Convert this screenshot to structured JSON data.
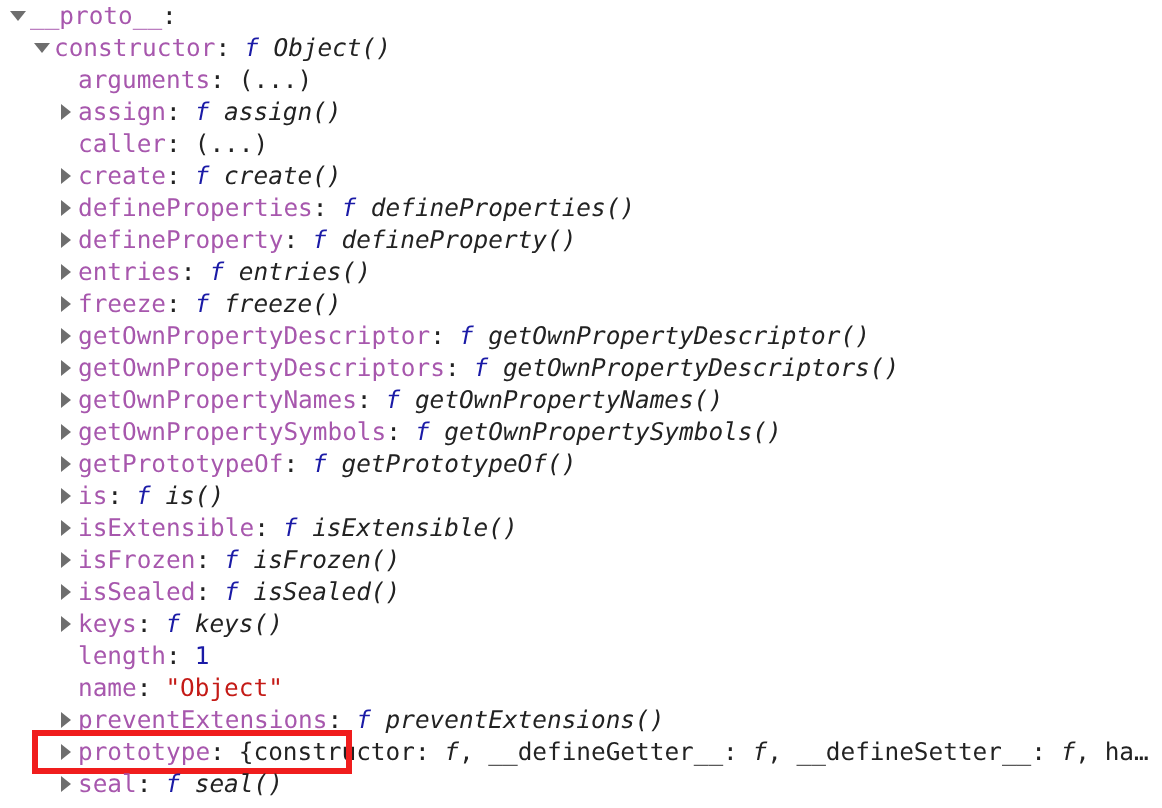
{
  "separator": ":",
  "tree": [
    {
      "key": "__proto__",
      "expanded": true,
      "children": [
        {
          "key": "constructor",
          "expanded": true,
          "value": {
            "kind": "function",
            "text": "**f** Object()"
          },
          "children": [
            {
              "key": "arguments",
              "value": {
                "kind": "plain",
                "text": "(...)"
              }
            },
            {
              "key": "assign",
              "expanded": false,
              "value": {
                "kind": "function",
                "text": "**f** assign()"
              }
            },
            {
              "key": "caller",
              "value": {
                "kind": "plain",
                "text": "(...)"
              }
            },
            {
              "key": "create",
              "expanded": false,
              "value": {
                "kind": "function",
                "text": "**f** create()"
              }
            },
            {
              "key": "defineProperties",
              "expanded": false,
              "value": {
                "kind": "function",
                "text": "**f** defineProperties()"
              }
            },
            {
              "key": "defineProperty",
              "expanded": false,
              "value": {
                "kind": "function",
                "text": "**f** defineProperty()"
              }
            },
            {
              "key": "entries",
              "expanded": false,
              "value": {
                "kind": "function",
                "text": "**f** entries()"
              }
            },
            {
              "key": "freeze",
              "expanded": false,
              "value": {
                "kind": "function",
                "text": "**f** freeze()"
              }
            },
            {
              "key": "getOwnPropertyDescriptor",
              "expanded": false,
              "value": {
                "kind": "function",
                "text": "**f** getOwnPropertyDescriptor()"
              }
            },
            {
              "key": "getOwnPropertyDescriptors",
              "expanded": false,
              "value": {
                "kind": "function",
                "text": "**f** getOwnPropertyDescriptors()"
              }
            },
            {
              "key": "getOwnPropertyNames",
              "expanded": false,
              "value": {
                "kind": "function",
                "text": "**f** getOwnPropertyNames()"
              }
            },
            {
              "key": "getOwnPropertySymbols",
              "expanded": false,
              "value": {
                "kind": "function",
                "text": "**f** getOwnPropertySymbols()"
              }
            },
            {
              "key": "getPrototypeOf",
              "expanded": false,
              "value": {
                "kind": "function",
                "text": "**f** getPrototypeOf()"
              }
            },
            {
              "key": "is",
              "expanded": false,
              "value": {
                "kind": "function",
                "text": "**f** is()"
              }
            },
            {
              "key": "isExtensible",
              "expanded": false,
              "value": {
                "kind": "function",
                "text": "**f** isExtensible()"
              }
            },
            {
              "key": "isFrozen",
              "expanded": false,
              "value": {
                "kind": "function",
                "text": "**f** isFrozen()"
              }
            },
            {
              "key": "isSealed",
              "expanded": false,
              "value": {
                "kind": "function",
                "text": "**f** isSealed()"
              }
            },
            {
              "key": "keys",
              "expanded": false,
              "value": {
                "kind": "function",
                "text": "**f** keys()"
              }
            },
            {
              "key": "length",
              "value": {
                "kind": "number",
                "text": "1"
              }
            },
            {
              "key": "name",
              "value": {
                "kind": "string",
                "text": "\"Object\""
              }
            },
            {
              "key": "preventExtensions",
              "expanded": false,
              "value": {
                "kind": "function",
                "text": "**f** preventExtensions()"
              }
            },
            {
              "key": "prototype",
              "expanded": false,
              "highlighted": true,
              "value": {
                "kind": "object",
                "text": "{constructor: *f*, __defineGetter__: *f*, __defineSetter__: *f*, ha…"
              }
            },
            {
              "key": "seal",
              "expanded": false,
              "value": {
                "kind": "function",
                "text": "**f** seal()"
              }
            }
          ]
        }
      ]
    }
  ]
}
